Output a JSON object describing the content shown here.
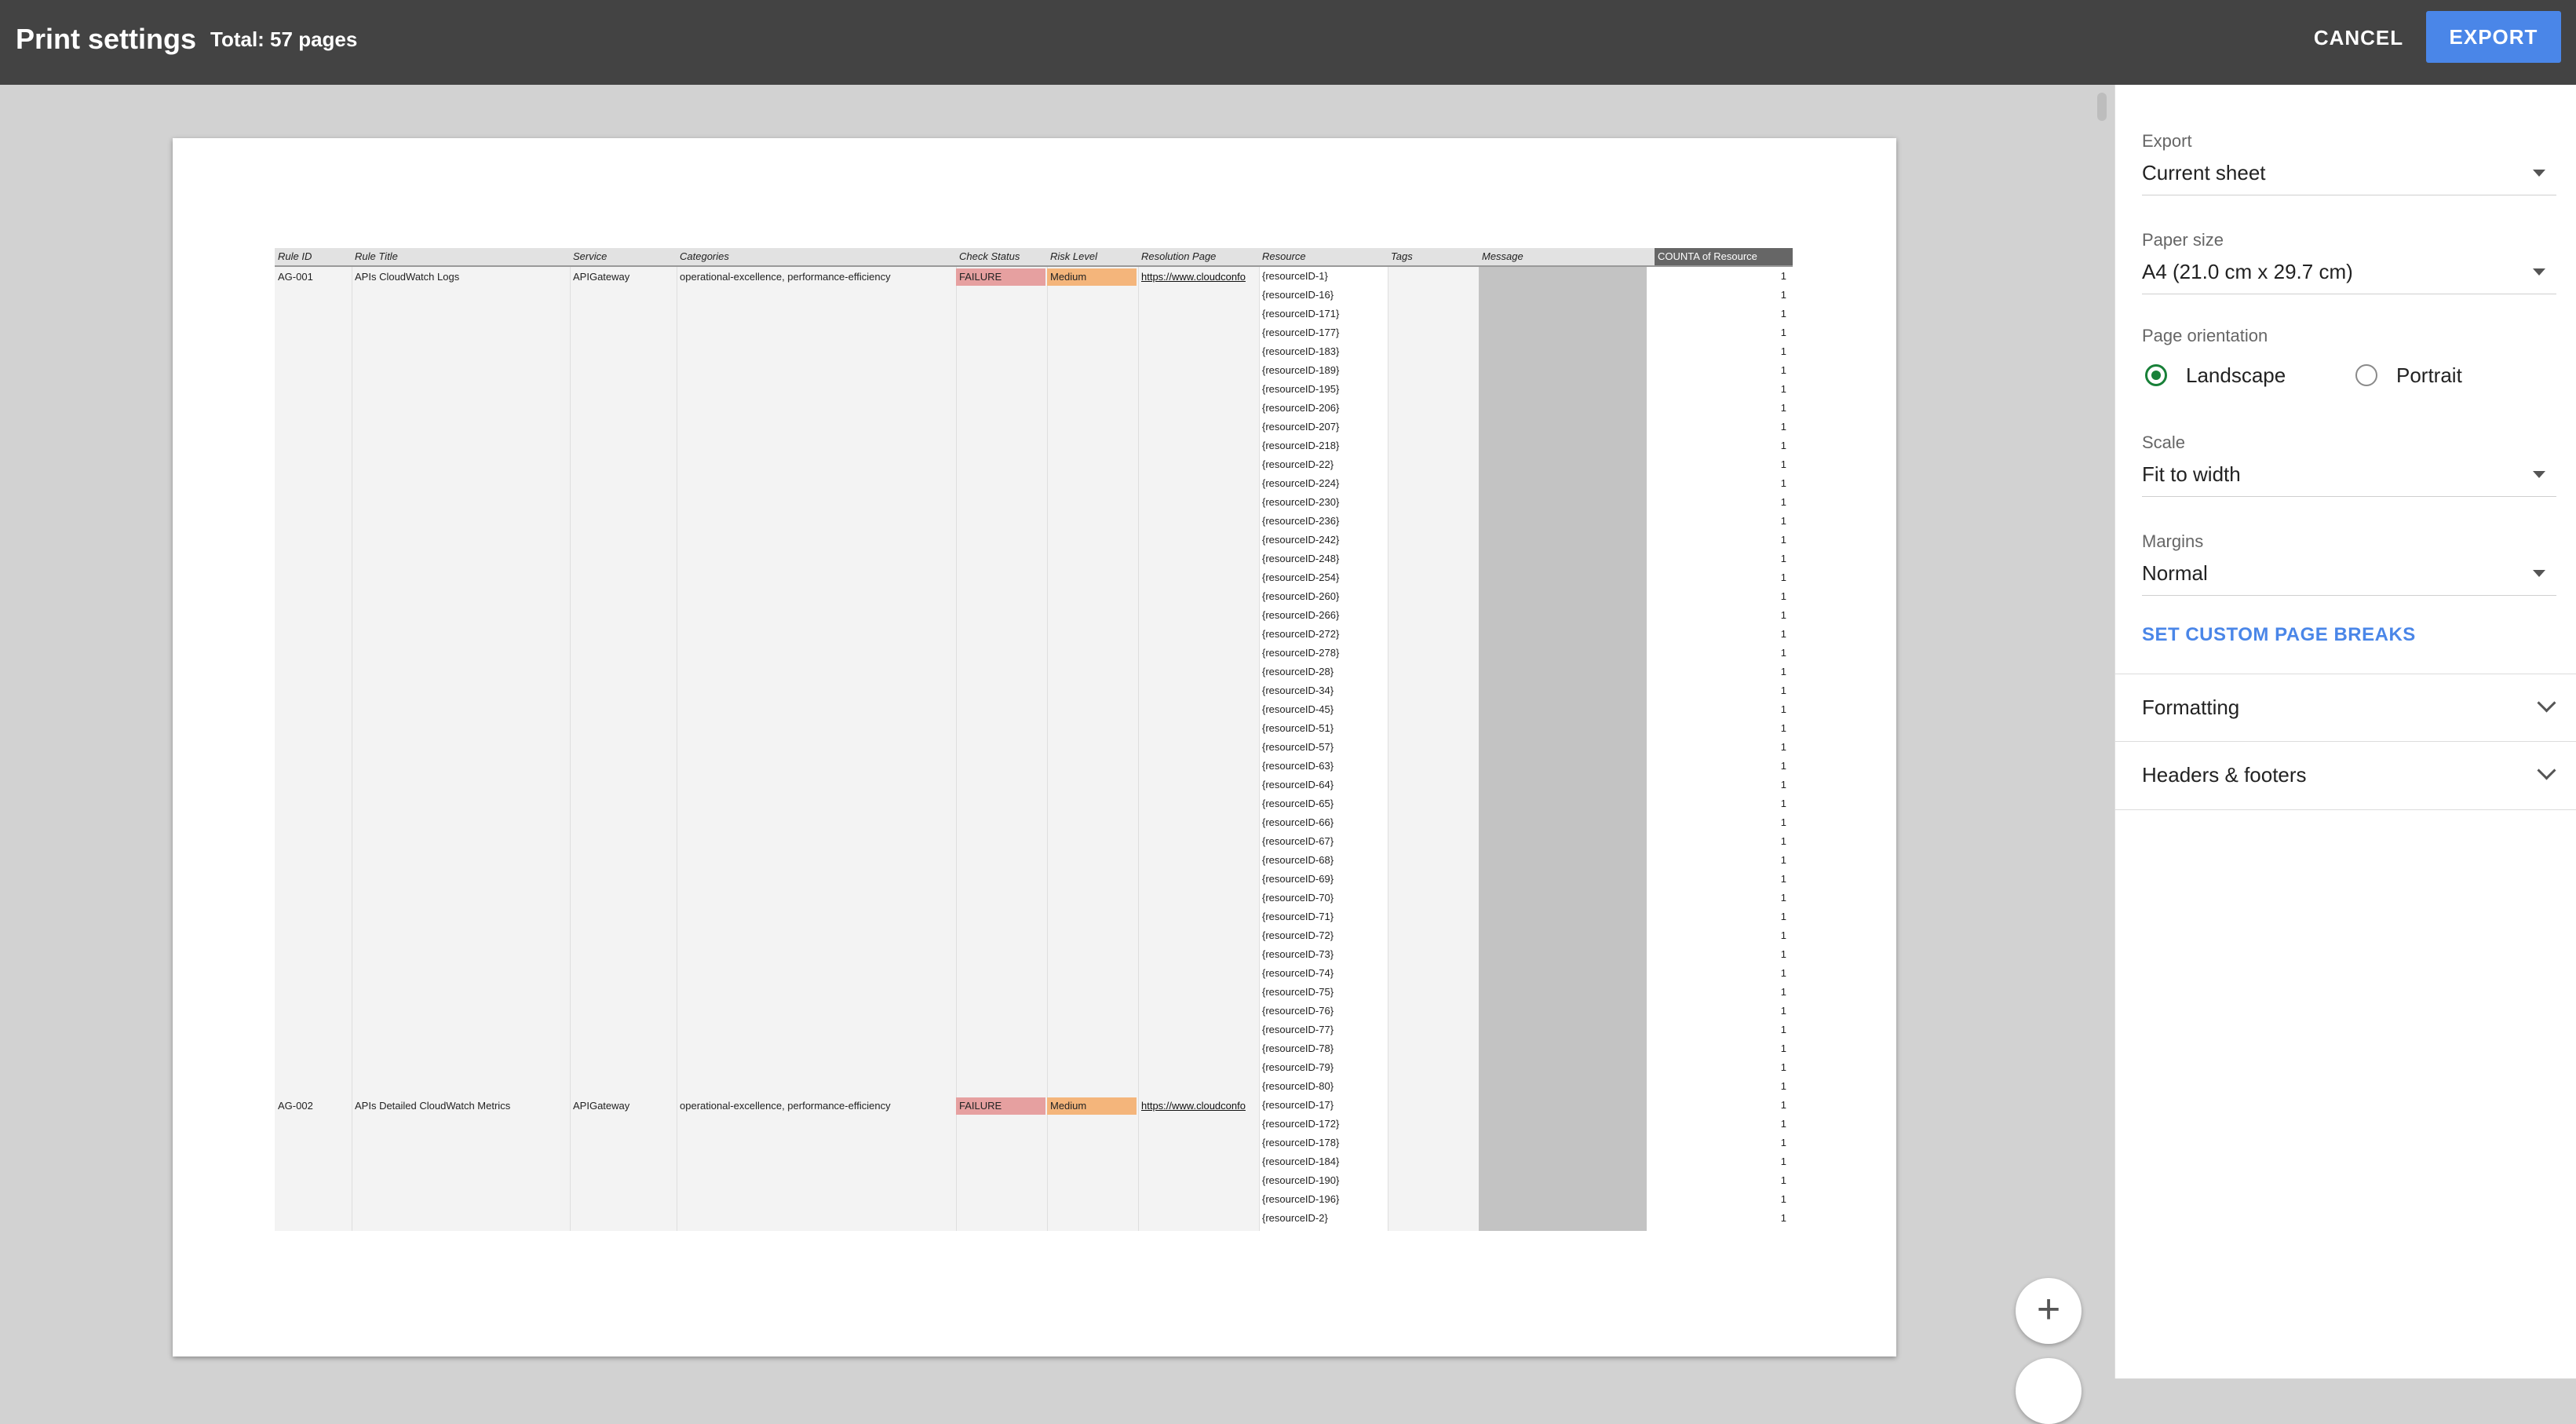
{
  "header": {
    "title": "Print settings",
    "total_pages": "Total: 57 pages",
    "cancel_label": "CANCEL",
    "export_label": "EXPORT"
  },
  "sheet": {
    "columns": [
      "Rule ID",
      "Rule Title",
      "Service",
      "Categories",
      "Check Status",
      "Risk Level",
      "Resolution Page",
      "Resource",
      "Tags",
      "Message",
      "COUNTA of Resource"
    ],
    "groups": [
      {
        "rule_id": "AG-001",
        "rule_title": "APIs CloudWatch Logs",
        "service": "APIGateway",
        "categories": "operational-excellence, performance-efficiency",
        "check_status": "FAILURE",
        "risk_level": "Medium",
        "resolution_page": "https://www.cloudconfo",
        "resources": [
          "{resourceID-1}",
          "{resourceID-16}",
          "{resourceID-171}",
          "{resourceID-177}",
          "{resourceID-183}",
          "{resourceID-189}",
          "{resourceID-195}",
          "{resourceID-206}",
          "{resourceID-207}",
          "{resourceID-218}",
          "{resourceID-22}",
          "{resourceID-224}",
          "{resourceID-230}",
          "{resourceID-236}",
          "{resourceID-242}",
          "{resourceID-248}",
          "{resourceID-254}",
          "{resourceID-260}",
          "{resourceID-266}",
          "{resourceID-272}",
          "{resourceID-278}",
          "{resourceID-28}",
          "{resourceID-34}",
          "{resourceID-45}",
          "{resourceID-51}",
          "{resourceID-57}",
          "{resourceID-63}",
          "{resourceID-64}",
          "{resourceID-65}",
          "{resourceID-66}",
          "{resourceID-67}",
          "{resourceID-68}",
          "{resourceID-69}",
          "{resourceID-70}",
          "{resourceID-71}",
          "{resourceID-72}",
          "{resourceID-73}",
          "{resourceID-74}",
          "{resourceID-75}",
          "{resourceID-76}",
          "{resourceID-77}",
          "{resourceID-78}",
          "{resourceID-79}",
          "{resourceID-80}"
        ]
      },
      {
        "rule_id": "AG-002",
        "rule_title": "APIs Detailed CloudWatch Metrics",
        "service": "APIGateway",
        "categories": "operational-excellence, performance-efficiency",
        "check_status": "FAILURE",
        "risk_level": "Medium",
        "resolution_page": "https://www.cloudconfo",
        "resources": [
          "{resourceID-17}",
          "{resourceID-172}",
          "{resourceID-178}",
          "{resourceID-184}",
          "{resourceID-190}",
          "{resourceID-196}",
          "{resourceID-2}"
        ]
      }
    ],
    "count_value": "1"
  },
  "zoom": {
    "plus_glyph": "+"
  },
  "sidebar": {
    "export_label": "Export",
    "export_value": "Current sheet",
    "paper_label": "Paper size",
    "paper_value": "A4 (21.0 cm x 29.7 cm)",
    "orientation_label": "Page orientation",
    "orientation_landscape": "Landscape",
    "orientation_portrait": "Portrait",
    "orientation_selected": "Landscape",
    "scale_label": "Scale",
    "scale_value": "Fit to width",
    "margins_label": "Margins",
    "margins_value": "Normal",
    "custom_breaks": "SET CUSTOM PAGE BREAKS",
    "formatting": "Formatting",
    "headers_footers": "Headers & footers"
  },
  "colors": {
    "accent": "#4a86e8",
    "failure": "#e6a0a0",
    "medium": "#f4b57b",
    "radio_selected": "#188038",
    "topbar": "#434343"
  }
}
